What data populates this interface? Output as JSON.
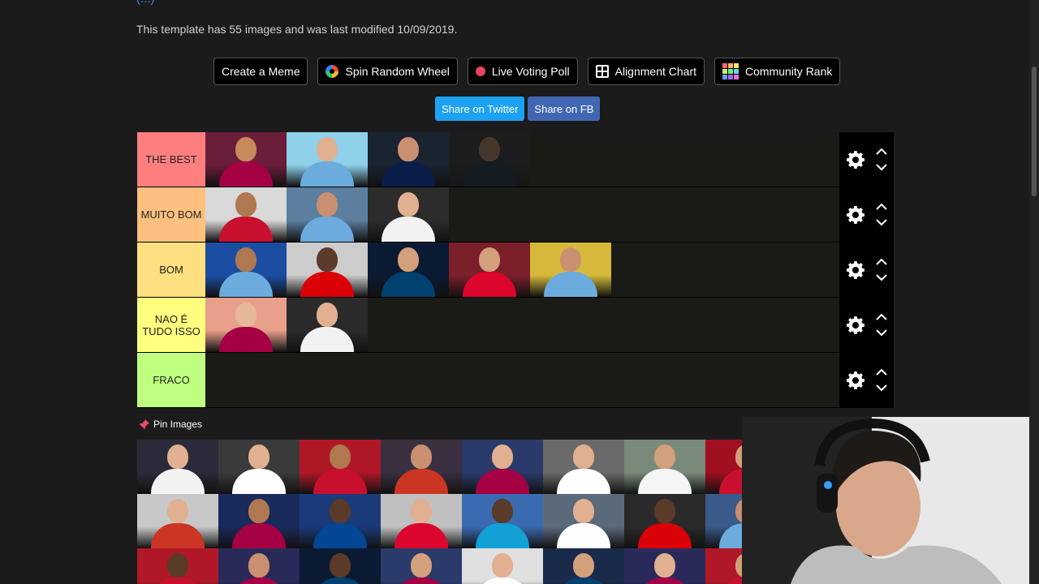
{
  "top_partial": "(...)",
  "template_info": "This template has 55 images and was last modified 10/09/2019.",
  "toolbar": {
    "create_meme": "Create a Meme",
    "spin_wheel": "Spin Random Wheel",
    "live_poll": "Live Voting Poll",
    "alignment_chart": "Alignment Chart",
    "community_rank": "Community Rank"
  },
  "share": {
    "twitter": "Share on Twitter",
    "facebook": "Share on FB"
  },
  "tiers": [
    {
      "label": "THE BEST",
      "color": "#ff7f7f",
      "players": [
        {
          "bg": "#6b1e3a",
          "kit": "#a50044",
          "skin": "#c68a5c"
        },
        {
          "bg": "#8fd0ea",
          "kit": "#6cabdd",
          "skin": "#e0b090"
        },
        {
          "bg": "#1a2330",
          "kit": "#0a1e4a",
          "skin": "#c89070"
        },
        {
          "bg": "#1a2330",
          "kit": "#0a1e4a",
          "skin": "#c89070",
          "ghost": true
        }
      ]
    },
    {
      "label": "MUITO BOM",
      "color": "#ffbf7f",
      "players": [
        {
          "bg": "#d9d9d9",
          "kit": "#c8102e",
          "skin": "#b07850"
        },
        {
          "bg": "#5c7fa0",
          "kit": "#6cabdd",
          "skin": "#c89070"
        },
        {
          "bg": "#2c2c2c",
          "kit": "#f2f2f2",
          "skin": "#e0b090"
        }
      ]
    },
    {
      "label": "BOM",
      "color": "#ffdf7f",
      "players": [
        {
          "bg": "#1b4ea3",
          "kit": "#6cabdd",
          "skin": "#b07850"
        },
        {
          "bg": "#cccccc",
          "kit": "#db0007",
          "skin": "#5a3a28"
        },
        {
          "bg": "#0b1a33",
          "kit": "#004170",
          "skin": "#d2a07a"
        },
        {
          "bg": "#7b1f2a",
          "kit": "#dc052d",
          "skin": "#d2a07a"
        },
        {
          "bg": "#d6b93a",
          "kit": "#6cabdd",
          "skin": "#c89070"
        }
      ]
    },
    {
      "label": "NAO É TUDO ISSO",
      "color": "#ffff7f",
      "players": [
        {
          "bg": "#e8a08a",
          "kit": "#a50044",
          "skin": "#e6b898"
        },
        {
          "bg": "#2a2a2a",
          "kit": "#f2f2f2",
          "skin": "#e0b090"
        }
      ]
    },
    {
      "label": "FRACO",
      "color": "#bfff7f",
      "players": []
    }
  ],
  "pin": {
    "title": "Pin Images",
    "players": [
      {
        "bg": "#2a2a3a",
        "kit": "#f2f2f2",
        "skin": "#e0b090"
      },
      {
        "bg": "#3a3a3a",
        "kit": "#ffffff",
        "skin": "#e0b090"
      },
      {
        "bg": "#b01828",
        "kit": "#c8102e",
        "skin": "#b07850"
      },
      {
        "bg": "#3a3040",
        "kit": "#cb3524",
        "skin": "#c89070"
      },
      {
        "bg": "#2a3a6a",
        "kit": "#a50044",
        "skin": "#e0b090"
      },
      {
        "bg": "#6a6a6a",
        "kit": "#ffffff",
        "skin": "#e0b090"
      },
      {
        "bg": "#7a8a7a",
        "kit": "#f5f5f5",
        "skin": "#d2a07a"
      },
      {
        "bg": "#a01020",
        "kit": "#c8102e",
        "skin": "#d2a07a"
      },
      {
        "bg": "#c8c8c8",
        "kit": "#cb3524",
        "skin": "#e0b090"
      },
      {
        "bg": "#1a2a5a",
        "kit": "#a50044",
        "skin": "#b07850"
      },
      {
        "bg": "#1a3a7a",
        "kit": "#034694",
        "skin": "#5a3a28"
      },
      {
        "bg": "#c0c0c0",
        "kit": "#dc052d",
        "skin": "#e0b090"
      },
      {
        "bg": "#3a6ab0",
        "kit": "#12a0d7",
        "skin": "#5a3a28"
      },
      {
        "bg": "#5a6a7a",
        "kit": "#ffffff",
        "skin": "#e0b090"
      },
      {
        "bg": "#2a2a2a",
        "kit": "#db0007",
        "skin": "#5a3a28"
      },
      {
        "bg": "#3a5a8a",
        "kit": "#6cabdd",
        "skin": "#c89070"
      },
      {
        "bg": "#b01828",
        "kit": "#c8102e",
        "skin": "#5a3a28"
      },
      {
        "bg": "#2a2a5a",
        "kit": "#a50044",
        "skin": "#c89070"
      },
      {
        "bg": "#0b1a33",
        "kit": "#004170",
        "skin": "#5a3a28"
      },
      {
        "bg": "#2a3a6a",
        "kit": "#a50044",
        "skin": "#d2a07a"
      },
      {
        "bg": "#e0e0e0",
        "kit": "#ffffff",
        "skin": "#e0b090"
      },
      {
        "bg": "#1a2a4a",
        "kit": "#004170",
        "skin": "#d2a07a"
      },
      {
        "bg": "#2a2a5a",
        "kit": "#a50044",
        "skin": "#e0b090"
      },
      {
        "bg": "#b01828",
        "kit": "#c8102e",
        "skin": "#d2a07a"
      }
    ]
  }
}
